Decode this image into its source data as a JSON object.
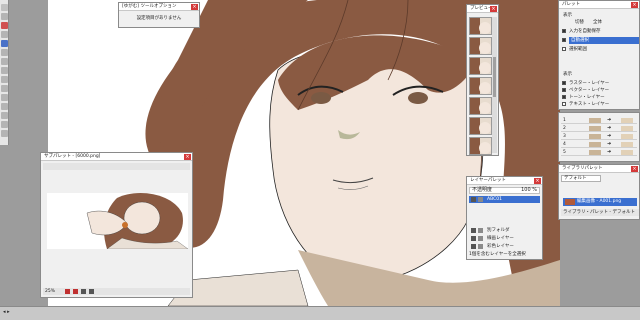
{
  "popup": {
    "title": "[ゆがむ] ツールオプション",
    "message": "設定項目がありません"
  },
  "subpalette": {
    "title": "サブパレット - [6000.png]",
    "zoom": "25%"
  },
  "layer_palette": {
    "title": "レイヤーパレット",
    "mode": "不透明度",
    "opacity": "100 %",
    "layers": [
      {
        "name": "ABC01",
        "selected": true
      },
      {
        "name": "別フォルダ",
        "selected": false
      },
      {
        "name": "線画レイヤー",
        "selected": false
      },
      {
        "name": "彩色レイヤー",
        "selected": false
      }
    ],
    "status": "1個を含むレイヤーを全選択"
  },
  "right_palette1": {
    "title": "パレット",
    "tabs": [
      "表示",
      "切替",
      "全体"
    ],
    "items": [
      {
        "label": "入力を自動保存",
        "checked": true
      },
      {
        "label": "自動選択",
        "checked": true
      },
      {
        "label": "選択範囲",
        "checked": false
      }
    ],
    "section_title": "表示",
    "options": [
      {
        "label": "ラスター・レイヤー",
        "checked": true
      },
      {
        "label": "ベクター・レイヤー",
        "checked": true
      },
      {
        "label": "トーン・レイヤー",
        "checked": true
      },
      {
        "label": "テキスト・レイヤー",
        "checked": false
      }
    ]
  },
  "right_palette2": {
    "rows": [
      "1",
      "2",
      "3",
      "4",
      "5"
    ]
  },
  "right_palette3": {
    "title": "ライブラリパレット",
    "field": "デフォルト",
    "selected_item": "編集画像 - A001.png",
    "sub_item": "ライブラリ・パレット - デフォルト"
  },
  "colors": {
    "hair": "#8a5a42",
    "skin": "#f3e6dc",
    "accent_blue": "#3a6fd0",
    "close_red": "#d43a3a"
  }
}
